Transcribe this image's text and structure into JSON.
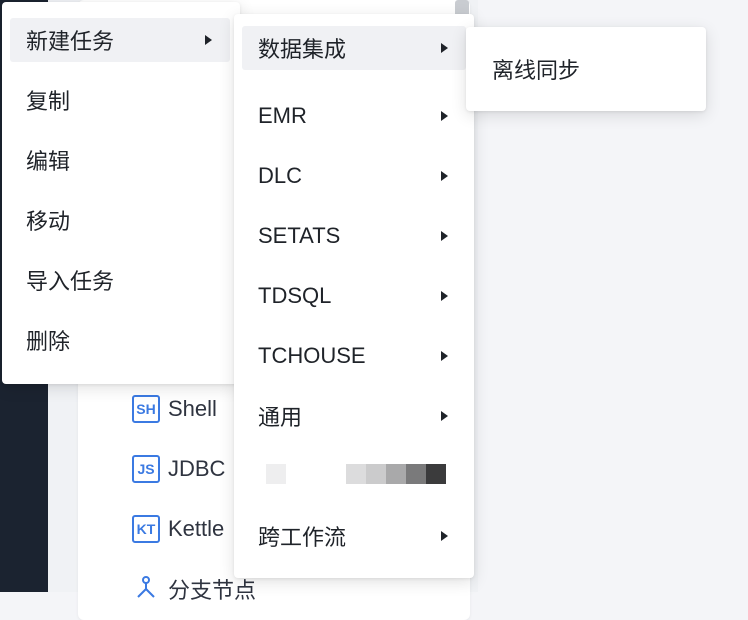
{
  "background_list": [
    {
      "badge": "SH",
      "label": "Shell"
    },
    {
      "badge": "JS",
      "label": "JDBC"
    },
    {
      "badge": "KT",
      "label": "Kettle"
    },
    {
      "badge": "",
      "label": "分支节点"
    }
  ],
  "context_menu": {
    "items": [
      {
        "label": "新建任务",
        "has_submenu": true,
        "active": true
      },
      {
        "label": "复制"
      },
      {
        "label": "编辑"
      },
      {
        "label": "移动"
      },
      {
        "label": "导入任务"
      },
      {
        "label": "删除"
      }
    ]
  },
  "submenu_new_task": {
    "items": [
      {
        "label": "数据集成",
        "has_submenu": true,
        "active": true
      },
      {
        "label": "EMR",
        "has_submenu": true
      },
      {
        "label": "DLC",
        "has_submenu": true
      },
      {
        "label": "SETATS",
        "has_submenu": true
      },
      {
        "label": "TDSQL",
        "has_submenu": true
      },
      {
        "label": "TCHOUSE",
        "has_submenu": true
      },
      {
        "label": "通用",
        "has_submenu": true
      },
      {
        "label": "",
        "blurred": true
      },
      {
        "label": "跨工作流",
        "has_submenu": true
      }
    ]
  },
  "submenu_data_integration": {
    "items": [
      {
        "label": "离线同步"
      }
    ]
  },
  "colors": {
    "accent": "#3b7ae2",
    "active_bg": "#f0f1f4",
    "sidebar_dark": "#1b2330"
  }
}
